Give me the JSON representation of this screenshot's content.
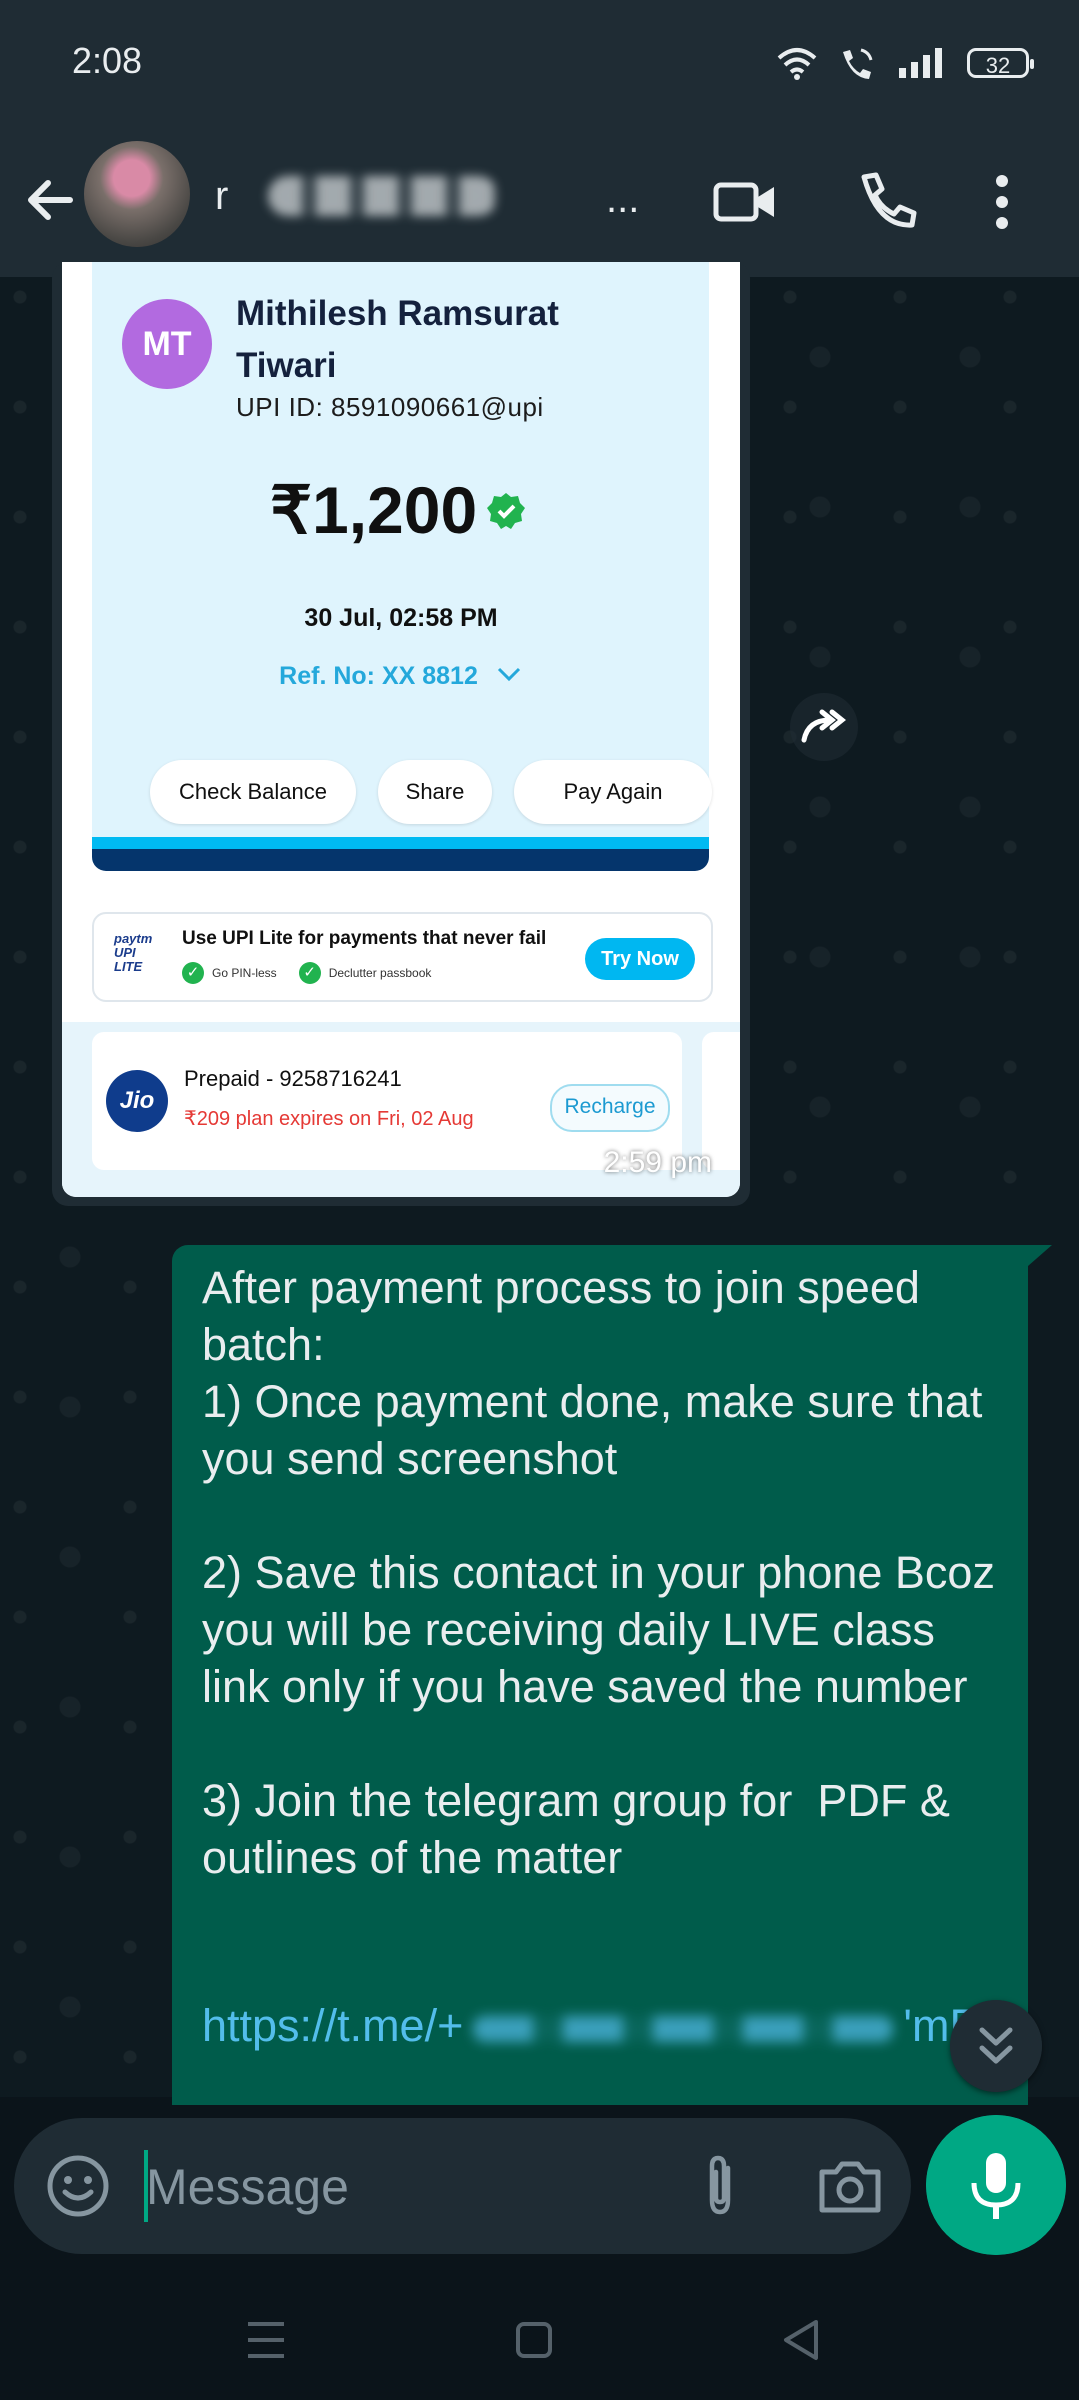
{
  "status_bar": {
    "time": "2:08",
    "battery": "32"
  },
  "header": {
    "contact_name": "r",
    "more_indicator": "..."
  },
  "image_message": {
    "receipt": {
      "avatar_initials": "MT",
      "payee_name": "Mithilesh Ramsurat Tiwari",
      "upi_id": "UPI ID: 8591090661@upi",
      "amount": "₹1,200",
      "datetime": "30 Jul, 02:58 PM",
      "ref": "Ref. No: XX 8812",
      "buttons": [
        "Check Balance",
        "Share",
        "Pay Again"
      ]
    },
    "promo": {
      "logo": "paytm UPI LITE",
      "text": "Use UPI Lite for payments that never fail",
      "features": [
        "Go PIN-less",
        "Declutter passbook"
      ],
      "cta": "Try Now"
    },
    "jio": {
      "logo": "Jio",
      "title": "Prepaid - 9258716241",
      "subtitle": "₹209 plan expires on Fri, 02 Aug",
      "cta": "Recharge"
    },
    "time": "2:59 pm"
  },
  "outgoing_message": {
    "text": "After payment process to join speed batch:\n1) Once payment done, make sure that you send screenshot\n\n2) Save this contact in your phone Bcoz you will be receiving daily LIVE class link only if you have saved the number\n\n3) Join the telegram group for  PDF & outlines of the matter",
    "link_start": "https://t.me/+",
    "link_end": "'mE9"
  },
  "composer": {
    "placeholder": "Message"
  },
  "colors": {
    "accent": "#00a884",
    "outgoing_bubble": "#005c4b",
    "header": "#1f2c34",
    "link": "#53bdeb"
  }
}
